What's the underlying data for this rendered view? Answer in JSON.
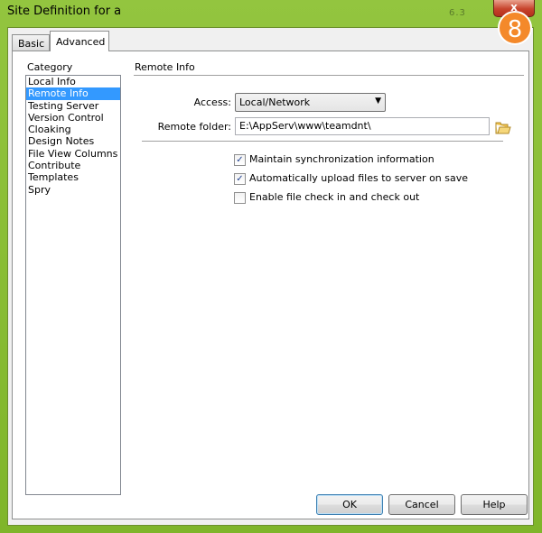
{
  "window": {
    "title": "Site Definition for a",
    "title_ghost": "6.3",
    "close_label": "x",
    "badge_label": "8"
  },
  "tabs": [
    {
      "label": "Basic",
      "active": false
    },
    {
      "label": "Advanced",
      "active": true
    }
  ],
  "category": {
    "heading": "Category",
    "items": [
      {
        "label": "Local Info",
        "selected": false
      },
      {
        "label": "Remote Info",
        "selected": true
      },
      {
        "label": "Testing Server",
        "selected": false
      },
      {
        "label": "Version Control",
        "selected": false
      },
      {
        "label": "Cloaking",
        "selected": false
      },
      {
        "label": "Design Notes",
        "selected": false
      },
      {
        "label": "File View Columns",
        "selected": false
      },
      {
        "label": "Contribute",
        "selected": false
      },
      {
        "label": "Templates",
        "selected": false
      },
      {
        "label": "Spry",
        "selected": false
      }
    ]
  },
  "remote_info": {
    "section_title": "Remote Info",
    "access_label": "Access:",
    "access_value": "Local/Network",
    "remote_folder_label": "Remote folder:",
    "remote_folder_value": "E:\\AppServ\\www\\teamdnt\\",
    "options": [
      {
        "label": "Maintain synchronization information",
        "checked": true
      },
      {
        "label": "Automatically upload files to server on save",
        "checked": true
      },
      {
        "label": "Enable file check in and check out",
        "checked": false
      }
    ]
  },
  "buttons": {
    "ok": "OK",
    "cancel": "Cancel",
    "help": "Help"
  },
  "colors": {
    "titlebar": "#7fb52a",
    "selection": "#3399ff",
    "close": "#c7432c",
    "badge": "#f4892a"
  },
  "icons": {
    "close": "close-icon",
    "dropdown": "chevron-down-icon",
    "folder": "folder-icon",
    "check": "checkmark-icon"
  }
}
